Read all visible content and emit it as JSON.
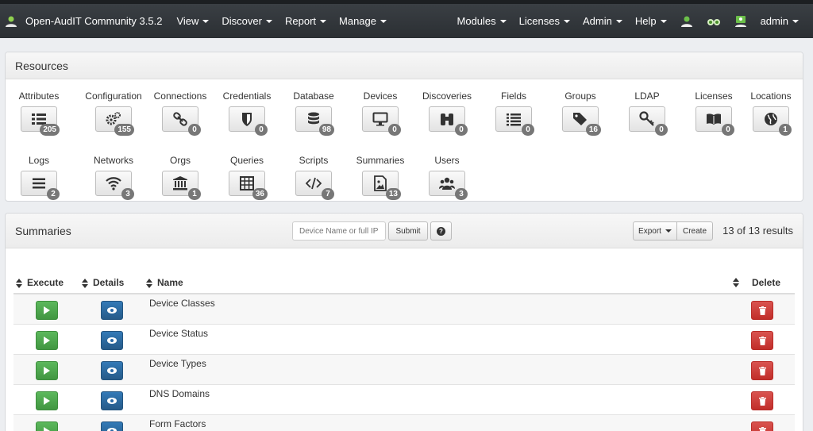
{
  "navbar": {
    "brand": "Open-AudIT Community 3.5.2",
    "left_menu": [
      "View",
      "Discover",
      "Report",
      "Manage"
    ],
    "right_menu": [
      "Modules",
      "Licenses",
      "Admin",
      "Help"
    ],
    "user": "admin"
  },
  "resources": {
    "title": "Resources",
    "items": [
      {
        "label": "Attributes",
        "count": "205",
        "icon": "list-icon"
      },
      {
        "label": "Configuration",
        "count": "155",
        "icon": "cogs-icon"
      },
      {
        "label": "Connections",
        "count": "0",
        "icon": "link-icon"
      },
      {
        "label": "Credentials",
        "count": "0",
        "icon": "shield-icon"
      },
      {
        "label": "Database",
        "count": "98",
        "icon": "database-icon"
      },
      {
        "label": "Devices",
        "count": "0",
        "icon": "desktop-icon"
      },
      {
        "label": "Discoveries",
        "count": "0",
        "icon": "binoculars-icon"
      },
      {
        "label": "Fields",
        "count": "0",
        "icon": "list-ul-icon"
      },
      {
        "label": "Groups",
        "count": "16",
        "icon": "tags-icon"
      },
      {
        "label": "LDAP",
        "count": "0",
        "icon": "key-icon"
      },
      {
        "label": "Licenses",
        "count": "0",
        "icon": "book-icon"
      },
      {
        "label": "Locations",
        "count": "1",
        "icon": "globe-icon"
      },
      {
        "label": "Logs",
        "count": "2",
        "icon": "bars-icon"
      },
      {
        "label": "Networks",
        "count": "3",
        "icon": "wifi-icon"
      },
      {
        "label": "Orgs",
        "count": "1",
        "icon": "bank-icon"
      },
      {
        "label": "Queries",
        "count": "36",
        "icon": "table-icon"
      },
      {
        "label": "Scripts",
        "count": "7",
        "icon": "code-icon"
      },
      {
        "label": "Summaries",
        "count": "13",
        "icon": "image-icon"
      },
      {
        "label": "Users",
        "count": "3",
        "icon": "users-icon"
      }
    ]
  },
  "summaries": {
    "title": "Summaries",
    "search_placeholder": "Device Name or full IP",
    "submit_label": "Submit",
    "help_label": "?",
    "export_label": "Export",
    "create_label": "Create",
    "results_text": "13 of 13 results",
    "columns": {
      "execute": "Execute",
      "details": "Details",
      "name": "Name",
      "delete": "Delete"
    },
    "rows": [
      {
        "name": "Device Classes"
      },
      {
        "name": "Device Status"
      },
      {
        "name": "Device Types"
      },
      {
        "name": "DNS Domains"
      },
      {
        "name": "Form Factors"
      }
    ]
  },
  "colors": {
    "navbar_bg": "#2e3338",
    "badge_bg": "#777777",
    "execute_green": "#5cb85c",
    "details_blue": "#337ab7",
    "delete_red": "#d9534f"
  }
}
